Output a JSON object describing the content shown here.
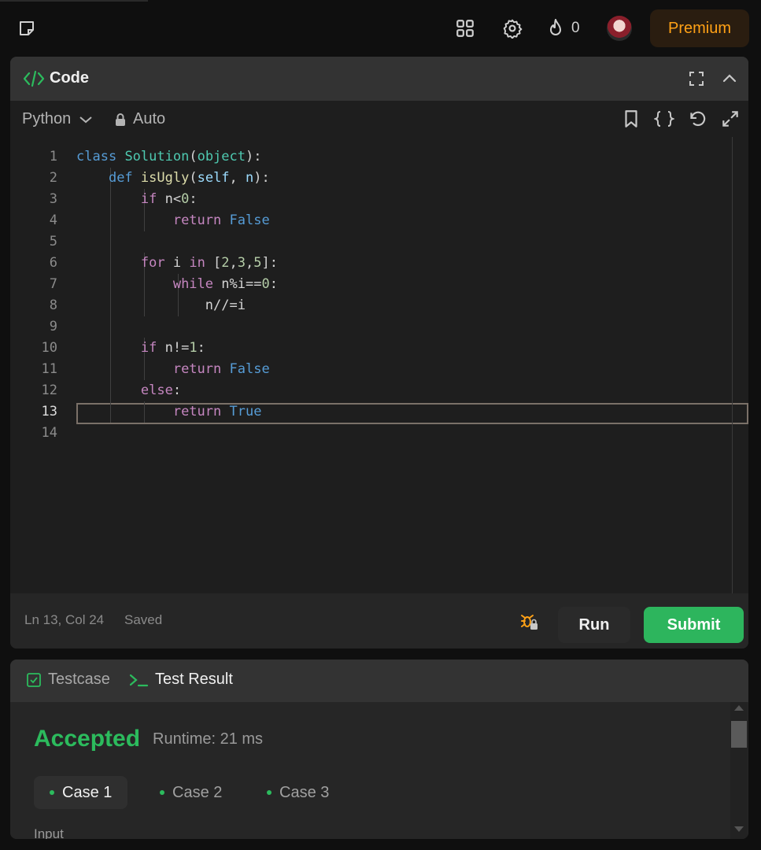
{
  "topbar": {
    "streak_count": "0",
    "premium_label": "Premium",
    "premium_color": "#ffa116"
  },
  "code_panel": {
    "title": "Code",
    "language": "Python",
    "mode": "Auto",
    "lines": [
      {
        "num": "1"
      },
      {
        "num": "2"
      },
      {
        "num": "3"
      },
      {
        "num": "4"
      },
      {
        "num": "5"
      },
      {
        "num": "6"
      },
      {
        "num": "7"
      },
      {
        "num": "8"
      },
      {
        "num": "9"
      },
      {
        "num": "10"
      },
      {
        "num": "11"
      },
      {
        "num": "12"
      },
      {
        "num": "13"
      },
      {
        "num": "14"
      }
    ],
    "code": {
      "l1": [
        "class",
        " ",
        "Solution",
        "(",
        "object",
        "):"
      ],
      "l2": [
        "    ",
        "def",
        " ",
        "isUgly",
        "(",
        "self",
        ", ",
        "n",
        "):"
      ],
      "l3": [
        "        ",
        "if",
        " n<",
        "0",
        ":"
      ],
      "l4": [
        "            ",
        "return",
        " ",
        "False"
      ],
      "l6": [
        "        ",
        "for",
        " i ",
        "in",
        " [",
        "2",
        ",",
        "3",
        ",",
        "5",
        "]:"
      ],
      "l7": [
        "            ",
        "while",
        " n%i==",
        "0",
        ":"
      ],
      "l8": [
        "                n//=i"
      ],
      "l10": [
        "        ",
        "if",
        " n!=",
        "1",
        ":"
      ],
      "l11": [
        "            ",
        "return",
        " ",
        "False"
      ],
      "l12": [
        "        ",
        "else",
        ":"
      ],
      "l13": [
        "            ",
        "return",
        " ",
        "True"
      ]
    },
    "status": {
      "position": "Ln 13, Col 24",
      "saved": "Saved"
    },
    "run_label": "Run",
    "submit_label": "Submit",
    "submit_color": "#2db55d"
  },
  "result_panel": {
    "tab_testcase": "Testcase",
    "tab_result": "Test Result",
    "verdict": "Accepted",
    "verdict_color": "#2cbb5d",
    "runtime": "Runtime: 21 ms",
    "cases": [
      "Case 1",
      "Case 2",
      "Case 3"
    ],
    "input_label": "Input"
  }
}
